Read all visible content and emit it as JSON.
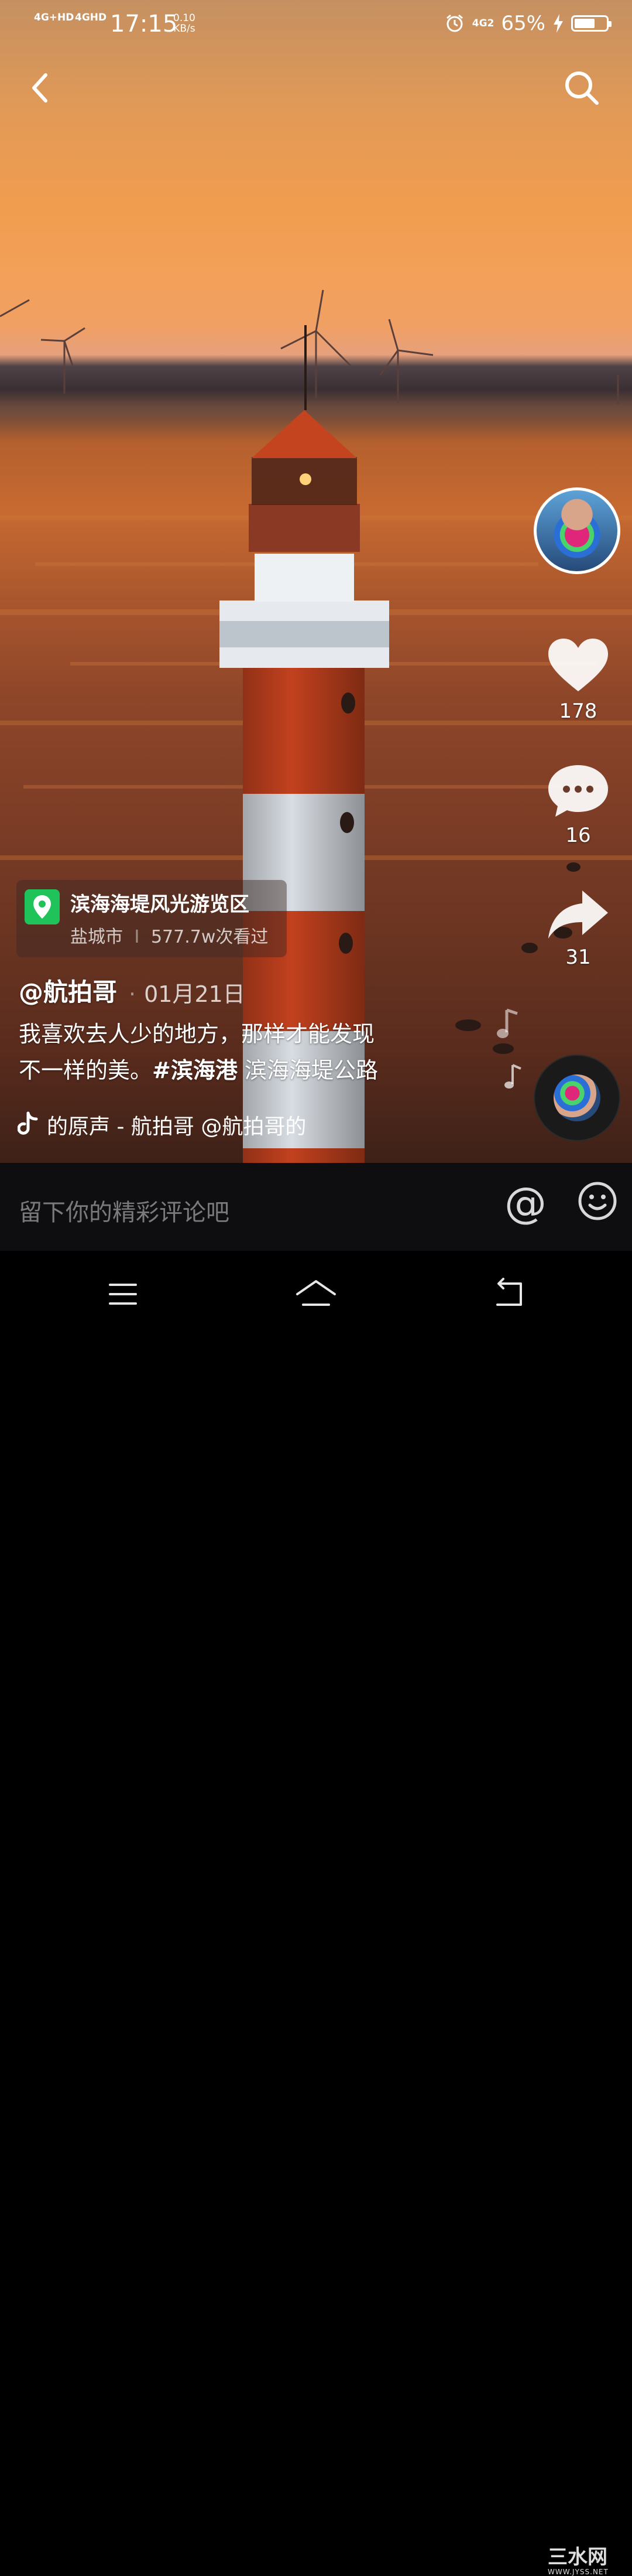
{
  "status_bar": {
    "signal_1": "4G+HD",
    "signal_2": "4GHD",
    "time": "17:15",
    "net_speed_value": "0.10",
    "net_speed_unit": "KB/s",
    "network_2": "4G2",
    "battery_percent": "65%",
    "battery_level": 0.65
  },
  "video": {
    "like_count": "178",
    "comment_count": "16",
    "share_count": "31",
    "location": {
      "name": "滨海海堤风光游览区",
      "city": "盐城市",
      "separator": "I",
      "views": "577.7w次看过"
    },
    "author": "@航拍哥",
    "date_separator": "·",
    "date": "01月21日",
    "caption_line1": "我喜欢去人少的地方，那样才能发现",
    "caption_line2_text": "不一样的美。",
    "caption_hashtag": "#滨海港",
    "caption_line2_rest": " 滨海海堤公路",
    "music": "的原声 - 航拍哥    @航拍哥的"
  },
  "comment_bar": {
    "placeholder": "留下你的精彩评论吧",
    "at_symbol": "@"
  },
  "watermark": {
    "text": "三水网",
    "url": "WWW.JYSS.NET"
  },
  "colors": {
    "location_pin": "#1fc35a",
    "comment_bar_bg": "#0e0e10"
  }
}
